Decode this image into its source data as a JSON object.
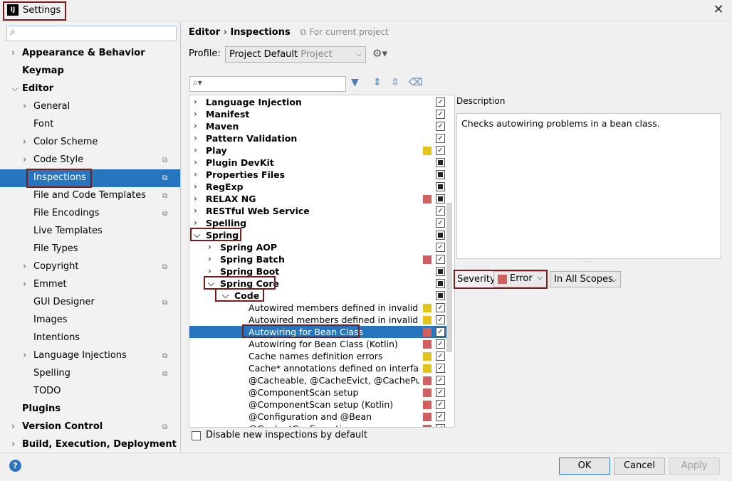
{
  "window": {
    "title": "Settings",
    "app_icon": "IJ"
  },
  "left_tree": {
    "search_placeholder": "",
    "items": [
      {
        "label": "Appearance & Behavior",
        "level": 0,
        "bold": true,
        "arrow": "collapsed"
      },
      {
        "label": "Keymap",
        "level": 0,
        "bold": true,
        "arrow": "none"
      },
      {
        "label": "Editor",
        "level": 0,
        "bold": true,
        "arrow": "expanded"
      },
      {
        "label": "General",
        "level": 1,
        "arrow": "collapsed"
      },
      {
        "label": "Font",
        "level": 1,
        "arrow": "none"
      },
      {
        "label": "Color Scheme",
        "level": 1,
        "arrow": "collapsed"
      },
      {
        "label": "Code Style",
        "level": 1,
        "arrow": "collapsed",
        "project": true
      },
      {
        "label": "Inspections",
        "level": 1,
        "arrow": "none",
        "project": true,
        "selected": true
      },
      {
        "label": "File and Code Templates",
        "level": 1,
        "arrow": "none",
        "project": true
      },
      {
        "label": "File Encodings",
        "level": 1,
        "arrow": "none",
        "project": true
      },
      {
        "label": "Live Templates",
        "level": 1,
        "arrow": "none"
      },
      {
        "label": "File Types",
        "level": 1,
        "arrow": "none"
      },
      {
        "label": "Copyright",
        "level": 1,
        "arrow": "collapsed",
        "project": true
      },
      {
        "label": "Emmet",
        "level": 1,
        "arrow": "collapsed"
      },
      {
        "label": "GUI Designer",
        "level": 1,
        "arrow": "none",
        "project": true
      },
      {
        "label": "Images",
        "level": 1,
        "arrow": "none"
      },
      {
        "label": "Intentions",
        "level": 1,
        "arrow": "none"
      },
      {
        "label": "Language Injections",
        "level": 1,
        "arrow": "collapsed",
        "project": true
      },
      {
        "label": "Spelling",
        "level": 1,
        "arrow": "none",
        "project": true
      },
      {
        "label": "TODO",
        "level": 1,
        "arrow": "none"
      },
      {
        "label": "Plugins",
        "level": 0,
        "bold": true,
        "arrow": "none"
      },
      {
        "label": "Version Control",
        "level": 0,
        "bold": true,
        "arrow": "collapsed",
        "project": true
      },
      {
        "label": "Build, Execution, Deployment",
        "level": 0,
        "bold": true,
        "arrow": "collapsed"
      }
    ]
  },
  "header": {
    "crumb_1": "Editor",
    "crumb_sep": "›",
    "crumb_2": "Inspections",
    "scope_note": "For current project",
    "profile_label": "Profile:",
    "profile_value": "Project Default",
    "profile_sub": "Project"
  },
  "filter": {
    "placeholder": ""
  },
  "inspections": [
    {
      "label": "Language Injection",
      "level": 0,
      "bold": true,
      "arrow": "collapsed",
      "check": "checked",
      "sev": ""
    },
    {
      "label": "Manifest",
      "level": 0,
      "bold": true,
      "arrow": "collapsed",
      "check": "checked",
      "sev": ""
    },
    {
      "label": "Maven",
      "level": 0,
      "bold": true,
      "arrow": "collapsed",
      "check": "checked",
      "sev": ""
    },
    {
      "label": "Pattern Validation",
      "level": 0,
      "bold": true,
      "arrow": "collapsed",
      "check": "checked",
      "sev": ""
    },
    {
      "label": "Play",
      "level": 0,
      "bold": true,
      "arrow": "collapsed",
      "check": "checked",
      "sev": "#e3c41a"
    },
    {
      "label": "Plugin DevKit",
      "level": 0,
      "bold": true,
      "arrow": "collapsed",
      "check": "mixed",
      "sev": ""
    },
    {
      "label": "Properties Files",
      "level": 0,
      "bold": true,
      "arrow": "collapsed",
      "check": "mixed",
      "sev": ""
    },
    {
      "label": "RegExp",
      "level": 0,
      "bold": true,
      "arrow": "collapsed",
      "check": "mixed",
      "sev": ""
    },
    {
      "label": "RELAX NG",
      "level": 0,
      "bold": true,
      "arrow": "collapsed",
      "check": "mixed",
      "sev": "#d26060"
    },
    {
      "label": "RESTful Web Service",
      "level": 0,
      "bold": true,
      "arrow": "collapsed",
      "check": "checked",
      "sev": ""
    },
    {
      "label": "Spelling",
      "level": 0,
      "bold": true,
      "arrow": "collapsed",
      "check": "checked",
      "sev": ""
    },
    {
      "label": "Spring",
      "level": 0,
      "bold": true,
      "arrow": "expanded",
      "check": "mixed",
      "sev": ""
    },
    {
      "label": "Spring AOP",
      "level": 1,
      "bold": true,
      "arrow": "collapsed",
      "check": "checked",
      "sev": ""
    },
    {
      "label": "Spring Batch",
      "level": 1,
      "bold": true,
      "arrow": "collapsed",
      "check": "checked",
      "sev": "#d26060"
    },
    {
      "label": "Spring Boot",
      "level": 1,
      "bold": true,
      "arrow": "collapsed",
      "check": "mixed",
      "sev": ""
    },
    {
      "label": "Spring Core",
      "level": 1,
      "bold": true,
      "arrow": "expanded",
      "check": "mixed",
      "sev": ""
    },
    {
      "label": "Code",
      "level": 2,
      "bold": true,
      "arrow": "expanded",
      "check": "mixed",
      "sev": ""
    },
    {
      "label": "Autowired members defined in invalid Sp",
      "level": 3,
      "arrow": "none",
      "check": "checked",
      "sev": "#e3c41a"
    },
    {
      "label": "Autowired members defined in invalid Sp",
      "level": 3,
      "arrow": "none",
      "check": "checked",
      "sev": "#e3c41a"
    },
    {
      "label": "Autowiring for Bean Class",
      "level": 3,
      "arrow": "none",
      "check": "checked",
      "sev": "#d26060",
      "selected": true
    },
    {
      "label": "Autowiring for Bean Class (Kotlin)",
      "level": 3,
      "arrow": "none",
      "check": "checked",
      "sev": "#d26060"
    },
    {
      "label": "Cache names definition errors",
      "level": 3,
      "arrow": "none",
      "check": "checked",
      "sev": "#e3c41a"
    },
    {
      "label": "Cache* annotations defined on interfaces",
      "level": 3,
      "arrow": "none",
      "check": "checked",
      "sev": "#e3c41a"
    },
    {
      "label": "@Cacheable, @CacheEvict, @CachePut, @",
      "level": 3,
      "arrow": "none",
      "check": "checked",
      "sev": "#d26060"
    },
    {
      "label": "@ComponentScan setup",
      "level": 3,
      "arrow": "none",
      "check": "checked",
      "sev": "#d26060"
    },
    {
      "label": "@ComponentScan setup (Kotlin)",
      "level": 3,
      "arrow": "none",
      "check": "checked",
      "sev": "#d26060"
    },
    {
      "label": "@Configuration and @Bean",
      "level": 3,
      "arrow": "none",
      "check": "checked",
      "sev": "#d26060"
    },
    {
      "label": "@ContextConfiguration",
      "level": 3,
      "arrow": "none",
      "check": "checked",
      "sev": "#d26060"
    }
  ],
  "disable_new": {
    "label": "Disable new inspections by default"
  },
  "description": {
    "title": "Description",
    "text": "Checks autowiring problems in a bean class."
  },
  "severity": {
    "label": "Severity:",
    "value": "Error",
    "color": "#d26060",
    "scope": "In All Scopes"
  },
  "buttons": {
    "ok": "OK",
    "cancel": "Cancel",
    "apply": "Apply",
    "help": "?"
  },
  "colors": {
    "selection": "#2675bf",
    "highlight_border": "#7a1c1c",
    "error": "#d26060",
    "warning": "#e3c41a"
  },
  "icons": [
    "search-icon",
    "filter-icon",
    "expand-all-icon",
    "collapse-all-icon",
    "reset-icon",
    "gear-icon",
    "close-icon",
    "help-icon",
    "project-scope-icon"
  ]
}
